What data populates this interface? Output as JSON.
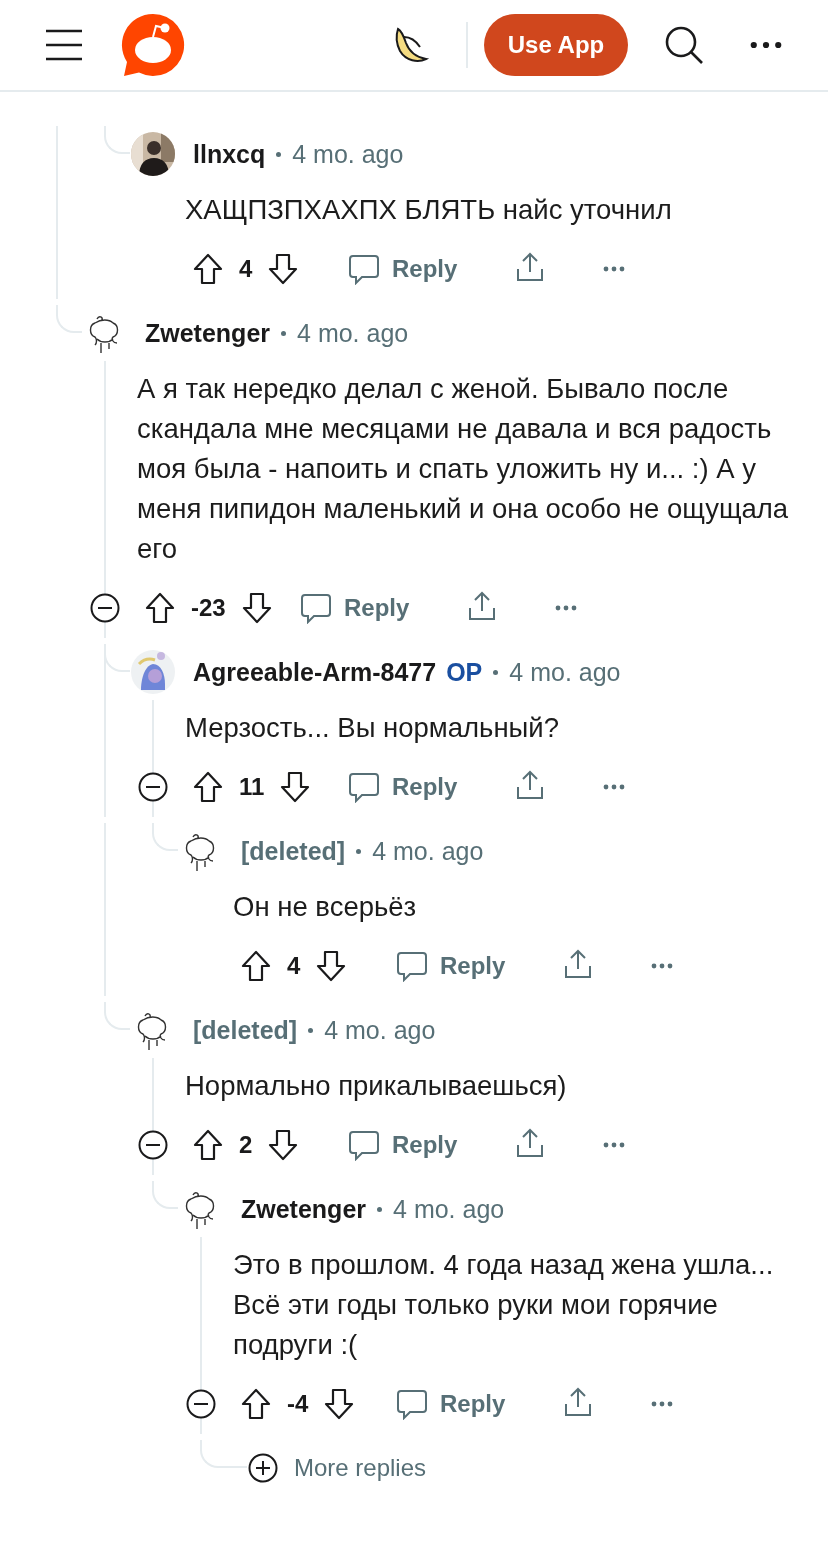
{
  "header": {
    "button": "Use App"
  },
  "comments": [
    {
      "kind": "offscreen",
      "children": [
        {
          "kind": "comment",
          "author": "llnxcq",
          "deleted": false,
          "time": "4 mo. ago",
          "text": "ХАЩПЗПХАХПХ БЛЯТЬ найс уточнил",
          "score": "4",
          "reply": "Reply"
        }
      ]
    },
    {
      "kind": "comment",
      "author": "Zwetenger",
      "deleted": false,
      "avatar": {
        "kind": "default"
      },
      "time": "4 mo. ago",
      "text": "А я так нередко делал с женой. Бывало после скандала мне месяцами не давала и вся радость моя была - напоить и спать уложить ну и... :) А у меня пипидон маленький и она особо не ощущала его",
      "score": "-23",
      "reply": "Reply",
      "children": [
        {
          "kind": "comment",
          "author": "Agreeable-Arm-8477",
          "op_label": "OP",
          "deleted": false,
          "avatar": {
            "kind": "character"
          },
          "time": "4 mo. ago",
          "text": "Мерзость... Вы нормальный?",
          "score": "11",
          "reply": "Reply",
          "children": [
            {
              "kind": "comment",
              "author": "[deleted]",
              "deleted": true,
              "avatar": {
                "kind": "default"
              },
              "time": "4 mo. ago",
              "text": "Он не всерьёз",
              "score": "4",
              "reply": "Reply"
            }
          ]
        },
        {
          "kind": "comment",
          "author": "[deleted]",
          "deleted": true,
          "avatar": {
            "kind": "default"
          },
          "time": "4 mo. ago",
          "text": "Нормально прикалываешься)",
          "score": "2",
          "reply": "Reply",
          "children": [
            {
              "kind": "comment",
              "author": "Zwetenger",
              "deleted": false,
              "avatar": {
                "kind": "default"
              },
              "time": "4 mo. ago",
              "text": "Это в прошлом. 4 года назад жена ушла... Всё эти годы только руки мои горячие подруги :(",
              "score": "-4",
              "reply": "Reply",
              "children": [
                {
                  "kind": "more",
                  "label": "More replies"
                }
              ]
            }
          ]
        }
      ]
    }
  ]
}
